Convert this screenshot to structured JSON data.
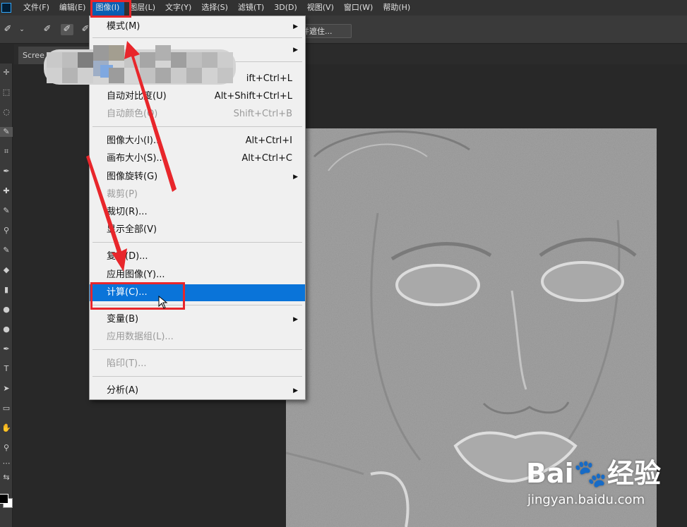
{
  "menubar": {
    "items": [
      "文件(F)",
      "编辑(E)",
      "图像(I)",
      "图层(L)",
      "文字(Y)",
      "选择(S)",
      "滤镜(T)",
      "3D(D)",
      "视图(V)",
      "窗口(W)",
      "帮助(H)"
    ],
    "active_index": 2
  },
  "options": {
    "refine_label": "并遮住..."
  },
  "tab": {
    "label": "Scree"
  },
  "menu": {
    "items": [
      {
        "label": "模式(M)",
        "shortcut": "",
        "submenu": true,
        "disabled": false
      },
      {
        "label": "",
        "shortcut": "",
        "submenu": true,
        "disabled": false
      },
      {
        "label": "",
        "shortcut": "ift+Ctrl+L",
        "submenu": false,
        "disabled": false
      },
      {
        "label": "自动对比度(U)",
        "shortcut": "Alt+Shift+Ctrl+L",
        "submenu": false,
        "disabled": false
      },
      {
        "label": "自动颜色(O)",
        "shortcut": "Shift+Ctrl+B",
        "submenu": false,
        "disabled": true
      },
      {
        "label": "图像大小(I)...",
        "shortcut": "Alt+Ctrl+I",
        "submenu": false,
        "disabled": false
      },
      {
        "label": "画布大小(S)...",
        "shortcut": "Alt+Ctrl+C",
        "submenu": false,
        "disabled": false
      },
      {
        "label": "图像旋转(G)",
        "shortcut": "",
        "submenu": true,
        "disabled": false
      },
      {
        "label": "裁剪(P)",
        "shortcut": "",
        "submenu": false,
        "disabled": true
      },
      {
        "label": "裁切(R)...",
        "shortcut": "",
        "submenu": false,
        "disabled": false
      },
      {
        "label": "显示全部(V)",
        "shortcut": "",
        "submenu": false,
        "disabled": false
      },
      {
        "label": "复制(D)...",
        "shortcut": "",
        "submenu": false,
        "disabled": false
      },
      {
        "label": "应用图像(Y)...",
        "shortcut": "",
        "submenu": false,
        "disabled": false
      },
      {
        "label": "计算(C)...",
        "shortcut": "",
        "submenu": false,
        "disabled": false,
        "highlighted": true
      },
      {
        "label": "变量(B)",
        "shortcut": "",
        "submenu": true,
        "disabled": false
      },
      {
        "label": "应用数据组(L)...",
        "shortcut": "",
        "submenu": false,
        "disabled": true
      },
      {
        "label": "陷印(T)...",
        "shortcut": "",
        "submenu": false,
        "disabled": true
      },
      {
        "label": "分析(A)",
        "shortcut": "",
        "submenu": true,
        "disabled": false
      }
    ]
  },
  "watermark": {
    "logo": "Bai🐾经验",
    "url": "jingyan.baidu.com"
  },
  "colors": {
    "accent": "#0a74d9",
    "annotation": "#e8262b",
    "menu_bg": "#f0f0f0",
    "app_bg": "#282828"
  }
}
